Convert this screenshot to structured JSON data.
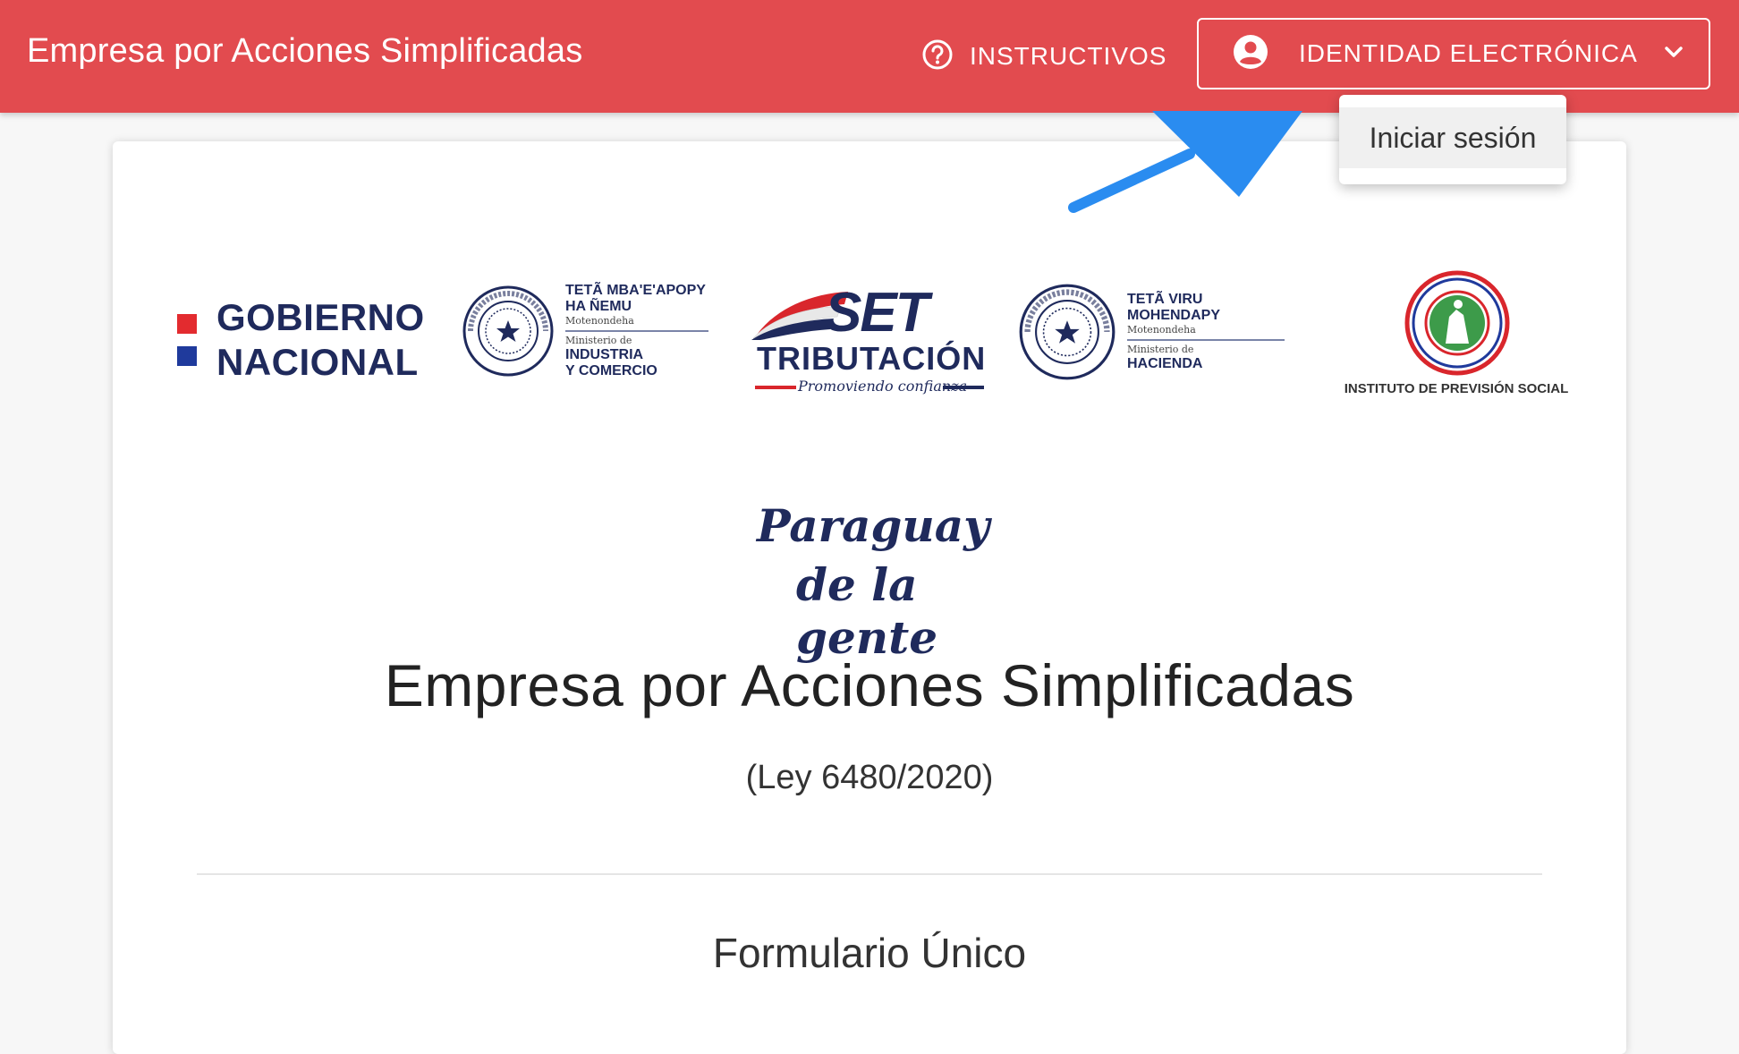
{
  "header": {
    "app_title": "Empresa por Acciones Simplificadas",
    "instructivos_label": "INSTRUCTIVOS",
    "identity_label": "IDENTIDAD ELECTRÓNICA"
  },
  "dropdown": {
    "items": [
      {
        "label": "Iniciar sesión"
      }
    ]
  },
  "logos": {
    "gobierno": {
      "line1": "GOBIERNO",
      "line2": "NACIONAL"
    },
    "industria": {
      "guarani1": "TETÃ MBA'E'APOPY",
      "guarani2": "HA ÑEMU",
      "motenondeha": "Motenondeha",
      "ministerio": "Ministerio de",
      "name1": "INDUSTRIA",
      "name2": "Y COMERCIO"
    },
    "set": {
      "brand": "SET",
      "name": "TRIBUTACIÓN",
      "lema": "Promoviendo confianza"
    },
    "hacienda": {
      "guarani1": "TETÃ VIRU",
      "guarani2": "MOHENDAPY",
      "motenondeha": "Motenondeha",
      "ministerio": "Ministerio de",
      "name": "HACIENDA"
    },
    "ips": {
      "caption": "INSTITUTO DE PREVISIÓN SOCIAL"
    },
    "paraguay": {
      "line1": "Paraguay",
      "line2": "de la gente"
    }
  },
  "main": {
    "title": "Empresa por Acciones Simplificadas",
    "subtitle": "(Ley 6480/2020)",
    "form_title": "Formulario Único"
  },
  "colors": {
    "header_bg": "#e24b4f",
    "navy": "#1f2a5c",
    "flag_red": "#d9262c",
    "annotation_arrow": "#2a8cf0"
  }
}
